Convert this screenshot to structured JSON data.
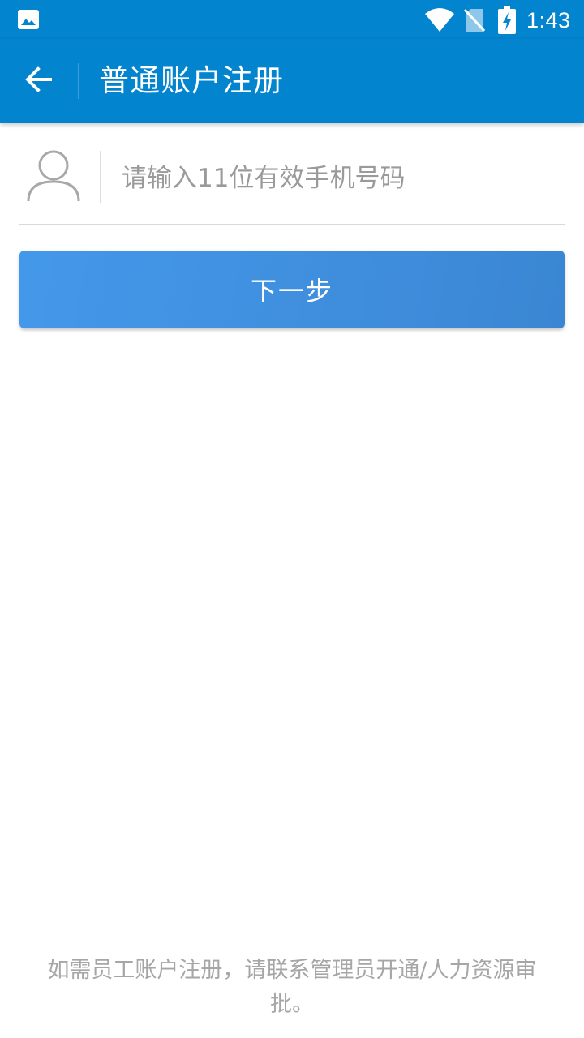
{
  "status_bar": {
    "time": "1:43",
    "icons": [
      "gallery-icon",
      "wifi-icon",
      "no-sim-icon",
      "battery-charging-icon"
    ],
    "background_color": "#0384cf"
  },
  "app_bar": {
    "back_icon": "arrow-left-icon",
    "title": "普通账户注册",
    "background_color": "#0384cf"
  },
  "phone_field": {
    "icon": "person-icon",
    "value": "",
    "placeholder": "请输入11位有效手机号码"
  },
  "next_button": {
    "label": "下一步",
    "color": "#4195e6"
  },
  "footer": {
    "note": "如需员工账户注册，请联系管理员开通/人力资源审批。"
  }
}
